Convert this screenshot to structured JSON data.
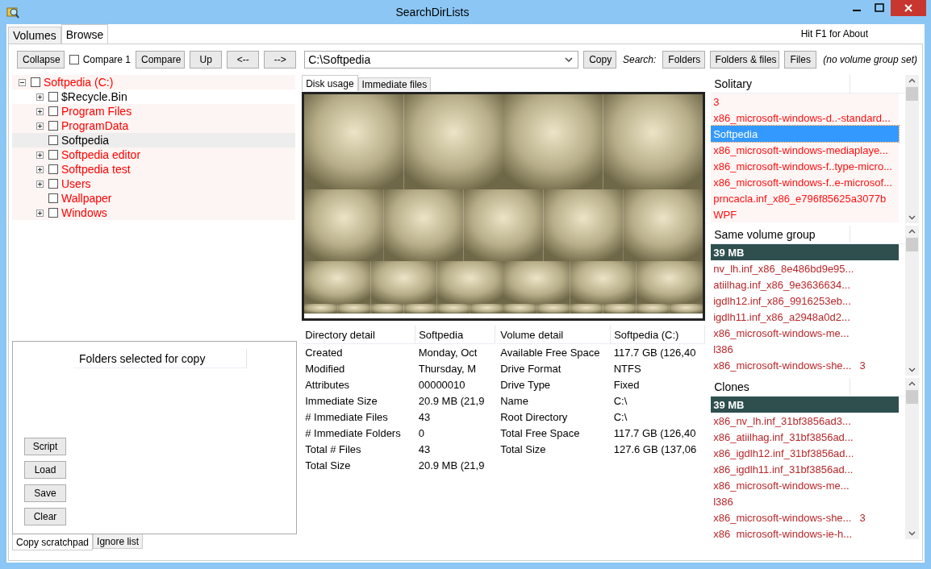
{
  "window": {
    "title": "SearchDirLists"
  },
  "tabs": [
    {
      "label": "Volumes",
      "selected": false
    },
    {
      "label": "Browse",
      "selected": true
    }
  ],
  "help_hint": "Hit F1 for About",
  "toolbar": [
    {
      "kind": "button",
      "label": "Collapse"
    },
    {
      "kind": "checkbox",
      "label": "Compare 1",
      "checked": false
    },
    {
      "kind": "button",
      "label": "Compare"
    },
    {
      "kind": "button",
      "label": "Up"
    },
    {
      "kind": "button",
      "label": "<--"
    },
    {
      "kind": "button",
      "label": "-->"
    },
    {
      "kind": "combo",
      "value": "C:\\Softpedia"
    },
    {
      "kind": "button",
      "label": "Copy"
    },
    {
      "kind": "label",
      "label": "Search:"
    },
    {
      "kind": "button",
      "label": "Folders"
    },
    {
      "kind": "button",
      "label": "Folders & files"
    },
    {
      "kind": "button",
      "label": "Files"
    },
    {
      "kind": "label",
      "label": "(no volume group set)"
    }
  ],
  "tree": [
    {
      "label": "Softpedia (C:)",
      "color": "#ff0000",
      "checked": false,
      "selected": false,
      "expanded": true,
      "children": [
        {
          "label": "$Recycle.Bin",
          "color": "#000000",
          "checked": false,
          "selected": false,
          "expanded": false
        },
        {
          "label": "Program Files",
          "color": "#ff0000",
          "checked": false,
          "selected": false,
          "expanded": false
        },
        {
          "label": "ProgramData",
          "color": "#ff0000",
          "checked": false,
          "selected": false,
          "expanded": false
        },
        {
          "label": "Softpedia",
          "color": "#000000",
          "checked": false,
          "selected": true
        },
        {
          "label": "Softpedia editor",
          "color": "#ff0000",
          "checked": false,
          "selected": false,
          "expanded": false
        },
        {
          "label": "Softpedia test",
          "color": "#ff0000",
          "checked": false,
          "selected": false,
          "expanded": false
        },
        {
          "label": "Users",
          "color": "#ff0000",
          "checked": false,
          "selected": false,
          "expanded": false
        },
        {
          "label": "Wallpaper",
          "color": "#ff0000",
          "checked": false,
          "selected": false
        },
        {
          "label": "Windows",
          "color": "#ff0000",
          "checked": false,
          "selected": false,
          "expanded": false
        }
      ]
    }
  ],
  "scratchpad": {
    "header": "Folders selected for copy",
    "buttons": [
      "Script",
      "Load",
      "Save",
      "Clear"
    ],
    "tabs": [
      {
        "label": "Copy scratchpad",
        "selected": true
      },
      {
        "label": "Ignore list",
        "selected": false
      }
    ]
  },
  "viewer_tabs": [
    {
      "label": "Disk usage",
      "selected": true
    },
    {
      "label": "Immediate files",
      "selected": false
    }
  ],
  "details": [
    {
      "columns": [
        "Directory detail",
        "Softpedia"
      ],
      "rows": [
        [
          "Created",
          "Monday, Oct"
        ],
        [
          "Modified",
          "Thursday, M"
        ],
        [
          "Attributes",
          "00000010"
        ],
        [
          "Immediate Size",
          "20.9 MB (21,9"
        ],
        [
          "# Immediate Files",
          "43"
        ],
        [
          "# Immediate Folders",
          "0"
        ],
        [
          "Total # Files",
          "43"
        ],
        [
          "Total Size",
          "20.9 MB (21,9"
        ]
      ]
    },
    {
      "columns": [
        "Volume detail",
        "Softpedia (C:)"
      ],
      "rows": [
        [
          "Available Free Space",
          "117.7 GB (126,40"
        ],
        [
          "Drive Format",
          "NTFS"
        ],
        [
          "Drive Type",
          "Fixed"
        ],
        [
          "Name",
          "C:\\"
        ],
        [
          "Root Directory",
          "C:\\"
        ],
        [
          "Total Free Space",
          "117.7 GB (126,40"
        ],
        [
          "Total Size",
          "127.6 GB (137,06"
        ]
      ]
    }
  ],
  "lists": [
    {
      "title": "Solitary",
      "rows": [
        {
          "kind": "item",
          "text": "3",
          "selected": false
        },
        {
          "kind": "item",
          "text": "x86_microsoft-windows-d..-standard...",
          "selected": false
        },
        {
          "kind": "item",
          "text": "Softpedia",
          "selected": true
        },
        {
          "kind": "item",
          "text": "x86_microsoft-windows-mediaplaye...",
          "selected": false
        },
        {
          "kind": "item",
          "text": "x86_microsoft-windows-f..type-micro...",
          "selected": false
        },
        {
          "kind": "item",
          "text": "x86_microsoft-windows-f..e-microsof...",
          "selected": false
        },
        {
          "kind": "item",
          "text": "prncacla.inf_x86_e796f85625a3077b",
          "selected": false
        },
        {
          "kind": "item",
          "text": "WPF",
          "selected": false
        }
      ]
    },
    {
      "title": "Same volume group",
      "rows": [
        {
          "kind": "group",
          "text": "39 MB",
          "selected": false
        },
        {
          "kind": "item",
          "text": "nv_lh.inf_x86_8e486bd9e95...",
          "selected": false
        },
        {
          "kind": "item",
          "text": "atiilhag.inf_x86_9e3636634...",
          "selected": false
        },
        {
          "kind": "item",
          "text": "igdlh12.inf_x86_9916253eb...",
          "selected": false
        },
        {
          "kind": "item",
          "text": "igdlh11.inf_x86_a2948a0d2...",
          "selected": false
        },
        {
          "kind": "item",
          "text": "x86_microsoft-windows-me...",
          "selected": false
        },
        {
          "kind": "item",
          "text": "l386",
          "selected": false
        },
        {
          "kind": "item",
          "text": "x86_microsoft-windows-she...",
          "count": "3",
          "selected": false
        }
      ]
    },
    {
      "title": "Clones",
      "rows": [
        {
          "kind": "group",
          "text": "39 MB",
          "selected": false
        },
        {
          "kind": "item",
          "text": "x86_nv_lh.inf_31bf3856ad3...",
          "selected": false
        },
        {
          "kind": "item",
          "text": "x86_atiilhag.inf_31bf3856ad...",
          "selected": false
        },
        {
          "kind": "item",
          "text": "x86_igdlh12.inf_31bf3856ad...",
          "selected": false
        },
        {
          "kind": "item",
          "text": "x86_igdlh11.inf_31bf3856ad...",
          "selected": false
        },
        {
          "kind": "item",
          "text": "x86_microsoft-windows-me...",
          "selected": false
        },
        {
          "kind": "item",
          "text": "l386",
          "selected": false
        },
        {
          "kind": "item",
          "text": "x86_microsoft-windows-she...",
          "count": "3",
          "selected": false
        },
        {
          "kind": "item",
          "text": "x86_microsoft-windows-ie-h...",
          "selected": false
        }
      ]
    }
  ]
}
